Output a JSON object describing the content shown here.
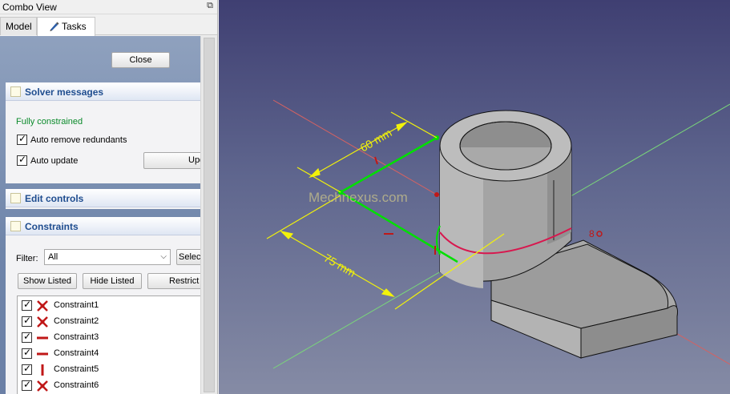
{
  "window": {
    "title": "Combo View"
  },
  "tabs": [
    {
      "label": "Model"
    },
    {
      "label": "Tasks"
    }
  ],
  "tasks": {
    "close_label": "Close",
    "solver": {
      "title": "Solver messages",
      "status": "Fully constrained",
      "auto_remove_label": "Auto remove redundants",
      "auto_update_label": "Auto update",
      "update_button": "Update"
    },
    "edit_controls": {
      "title": "Edit controls"
    },
    "constraints": {
      "title": "Constraints",
      "filter_label": "Filter:",
      "filter_value": "All",
      "select_button": "Select",
      "show_listed": "Show Listed",
      "hide_listed": "Hide Listed",
      "restrict": "Restrict",
      "items": [
        {
          "label": "Constraint1",
          "icon": "coincident-icon"
        },
        {
          "label": "Constraint2",
          "icon": "coincident-icon"
        },
        {
          "label": "Constraint3",
          "icon": "horizontal-icon"
        },
        {
          "label": "Constraint4",
          "icon": "horizontal-icon"
        },
        {
          "label": "Constraint5",
          "icon": "vertical-icon"
        },
        {
          "label": "Constraint6",
          "icon": "coincident-icon"
        }
      ]
    }
  },
  "viewport": {
    "dimension_60": "60 mm",
    "dimension_75": "75 mm",
    "watermark": "Mechnexus.com",
    "constraint_marker": "8"
  },
  "colors": {
    "panel_header_text": "#1f4d8f",
    "status_green": "#0a8a2a",
    "constraint_red": "#c01818",
    "dimension_yellow": "#f2f20a",
    "sketch_green": "#00e000"
  }
}
